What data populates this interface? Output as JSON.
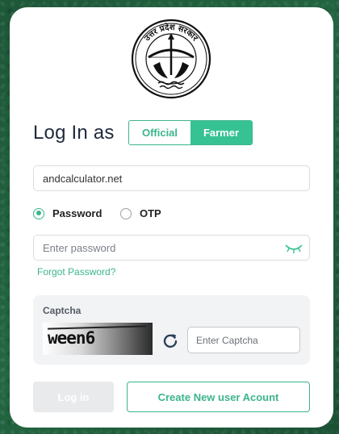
{
  "emblem": {
    "name": "up-government-seal",
    "inscription": "उत्तर प्रदेश सरकार"
  },
  "login": {
    "title": "Log In as",
    "roles": [
      "Official",
      "Farmer"
    ],
    "selected_role": "Farmer"
  },
  "username": {
    "value": "andcalculator.net"
  },
  "auth_mode": {
    "options": [
      {
        "label": "Password",
        "selected": true
      },
      {
        "label": "OTP",
        "selected": false
      }
    ]
  },
  "password": {
    "placeholder": "Enter password",
    "icon": "eye-closed-icon"
  },
  "forgot_label": "Forgot Password?",
  "captcha": {
    "label": "Captcha",
    "text": "ween6",
    "refresh_icon": "refresh-icon",
    "input_placeholder": "Enter Captcha"
  },
  "actions": {
    "login_label": "Log in",
    "create_label": "Create New user Acount"
  },
  "colors": {
    "accent": "#37c293",
    "title": "#1e2a3e",
    "background": "#1f5a3b"
  }
}
